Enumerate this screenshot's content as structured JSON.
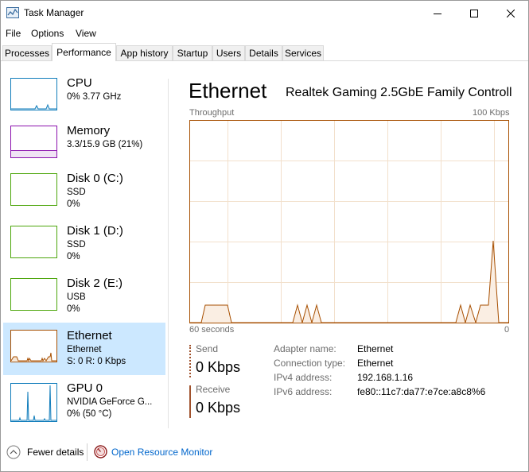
{
  "window": {
    "title": "Task Manager"
  },
  "menu": [
    "File",
    "Options",
    "View"
  ],
  "tabs": [
    "Processes",
    "Performance",
    "App history",
    "Startup",
    "Users",
    "Details",
    "Services"
  ],
  "active_tab": "Performance",
  "sidebar": [
    {
      "title": "CPU",
      "sub1": "0% 3.77 GHz",
      "sub2": "",
      "color": "#117dbb"
    },
    {
      "title": "Memory",
      "sub1": "3.3/15.9 GB (21%)",
      "sub2": "",
      "color": "#8b12ae"
    },
    {
      "title": "Disk 0 (C:)",
      "sub1": "SSD",
      "sub2": "0%",
      "color": "#4da60c"
    },
    {
      "title": "Disk 1 (D:)",
      "sub1": "SSD",
      "sub2": "0%",
      "color": "#4da60c"
    },
    {
      "title": "Disk 2 (E:)",
      "sub1": "USB",
      "sub2": "0%",
      "color": "#4da60c"
    },
    {
      "title": "Ethernet",
      "sub1": "Ethernet",
      "sub2": "S: 0  R: 0 Kbps",
      "color": "#a74f01"
    },
    {
      "title": "GPU 0",
      "sub1": "NVIDIA GeForce G...",
      "sub2": "0% (50 °C)",
      "color": "#117dbb"
    }
  ],
  "main": {
    "title": "Ethernet",
    "adapter": "Realtek Gaming 2.5GbE Family Controll...",
    "graph_label": "Throughput",
    "graph_max": "100 Kbps",
    "graph_time": "60 seconds",
    "graph_min": "0",
    "send_label": "Send",
    "send_value": "0 Kbps",
    "receive_label": "Receive",
    "receive_value": "0 Kbps",
    "details": [
      {
        "key": "Adapter name:",
        "value": "Ethernet"
      },
      {
        "key": "Connection type:",
        "value": "Ethernet"
      },
      {
        "key": "IPv4 address:",
        "value": "192.168.1.16"
      },
      {
        "key": "IPv6 address:",
        "value": "fe80::11c7:da77:e7ce:a8c8%6"
      }
    ],
    "accent_color": "#a74f01"
  },
  "footer": {
    "fewer_details": "Fewer details",
    "resource_monitor": "Open Resource Monitor"
  }
}
